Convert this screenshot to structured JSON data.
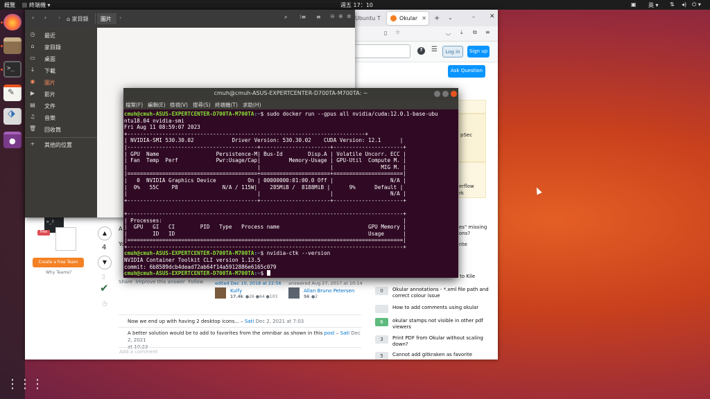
{
  "topbar": {
    "activities": "概覽",
    "app_menu": "終端機 ▾",
    "clock": "週五 17：10",
    "input_method": "英 ▾"
  },
  "dock": {
    "items": [
      {
        "name": "firefox",
        "color": "#e66000"
      },
      {
        "name": "files",
        "color": "#8b6f4e"
      },
      {
        "name": "terminal",
        "color": "#2c2c2c"
      },
      {
        "name": "text-editor",
        "color": "#f2f2f2"
      },
      {
        "name": "software",
        "color": "#dddddd"
      },
      {
        "name": "video",
        "color": "#7a3a8a"
      }
    ]
  },
  "firefox": {
    "tabs": [
      {
        "label": "Ubuntu T"
      },
      {
        "label": "Okular"
      }
    ],
    "so": {
      "login": "Log in",
      "signup": "Sign up",
      "ask": "Ask Question",
      "sidebar_fragments": [
        "pSec",
        "erflow",
        "rk"
      ],
      "votes": "4",
      "answer_links": "Share  Improve this answer  Follow",
      "edited": "edited Dec 10, 2018 at 22:56",
      "answered": "answered Aug 27, 2017 at 10:14",
      "editor_name": "Kulfy",
      "editor_rep": "17.4k",
      "editor_badges": "●26 ●64 ●103",
      "author_name": "Allan Bruno Petersen",
      "author_rep": "56",
      "author_badges": "●2",
      "teams_badge": "Free",
      "teams_button": "Create a free Team",
      "teams_why": "Why Teams?",
      "comment1_text": "Now we end up with having 2 desktop icons... –",
      "comment1_user": "Sati",
      "comment1_date": "Dec 2, 2021 at 7:03",
      "comment2_text": "A better solution would be to add to favorites from the omnibar as shown in this",
      "comment2_link": "post",
      "comment2_user": "Sati",
      "comment2_date": "Dec 2, 2021",
      "comment2_date2": "at 10:23",
      "add_comment": "Add a comment",
      "related_partial": [
        "es\" missing",
        "ons?",
        "rite"
      ],
      "related": [
        {
          "count": "0",
          "title": "Okular annotations - *.xml file path and correct colour issue",
          "answered": false
        },
        {
          "count": "",
          "title": "How to add comments using okular",
          "answered": false
        },
        {
          "count": "6",
          "title": "okular stamps not visible in other pdf viewers",
          "answered": true
        },
        {
          "count": "3",
          "title": "Print PDF from Okular without scaling down?",
          "answered": false
        },
        {
          "count": "5",
          "title": "Cannot add gitkraken as favorite",
          "answered": false
        }
      ],
      "related_cut": "Inverse search from Okular to Kile"
    }
  },
  "nautilus": {
    "path_home": "家目錄",
    "path_current": "圖片",
    "sidebar": [
      {
        "label": "最近",
        "icon": "◷"
      },
      {
        "label": "家目錄",
        "icon": "⌂"
      },
      {
        "label": "桌面",
        "icon": "▭"
      },
      {
        "label": "下載",
        "icon": "↓"
      },
      {
        "label": "圖片",
        "icon": "◉",
        "active": true
      },
      {
        "label": "影片",
        "icon": "▶"
      },
      {
        "label": "文件",
        "icon": "▤"
      },
      {
        "label": "音樂",
        "icon": "♫"
      },
      {
        "label": "回收筒",
        "icon": "🗑"
      },
      {
        "label": "其他的位置",
        "icon": "+"
      }
    ]
  },
  "terminal": {
    "title": "cmuh@cmuh-ASUS-EXPERTCENTER-D700TA-M700TA: ~",
    "menu": [
      "檔案(F)",
      "編輯(E)",
      "檢視(V)",
      "搜尋(S)",
      "終端機(T)",
      "求助(H)"
    ],
    "prompt_user": "cmuh@cmuh-ASUS-EXPERTCENTER-D700TA-M700TA",
    "prompt_path": ":~",
    "cmd1": "$ sudo docker run --gpus all nvidia/cuda:12.0.1-base-ubu",
    "output1": [
      "ntu18.04 nvidia-smi",
      "Fri Aug 11 08:59:07 2023",
      "+---------------------------------------------------------------------------+",
      "| NVIDIA-SMI 530.30.02            Driver Version: 530.30.02    CUDA Version: 12.1      |",
      "|-----------------------------------------+----------------------+----------------------+",
      "| GPU  Name                  Persistence-M| Bus-Id        Disp.A | Volatile Uncorr. ECC |",
      "| Fan  Temp  Perf            Pwr:Usage/Cap|         Memory-Usage | GPU-Util  Compute M. |",
      "|                                         |                      |               MIG M. |",
      "|=========================================+======================+======================|",
      "|   0  NVIDIA Graphics Device          On | 00000000:01:00.0 Off |                  N/A |",
      "|  0%   55C    P8              N/A / 115W|    285MiB /  8188MiB |      9%      Default |",
      "|                                         |                      |                  N/A |",
      "+-----------------------------------------+----------------------+----------------------+",
      "",
      "+---------------------------------------------------------------------------------------+",
      "| Processes:                                                                            |",
      "|  GPU   GI   CI        PID   Type   Process name                            GPU Memory |",
      "|        ID   ID                                                             Usage      |",
      "|=======================================================================================|",
      "+---------------------------------------------------------------------------------------+"
    ],
    "cmd2": "$ nvidia-ctk --version",
    "output2": [
      "NVIDIA Container Toolkit CLI version 1.13.5",
      "commit: 6b8589dcb4dead72ab64f14a5912886e6165c079"
    ],
    "cmd3": "$ "
  }
}
